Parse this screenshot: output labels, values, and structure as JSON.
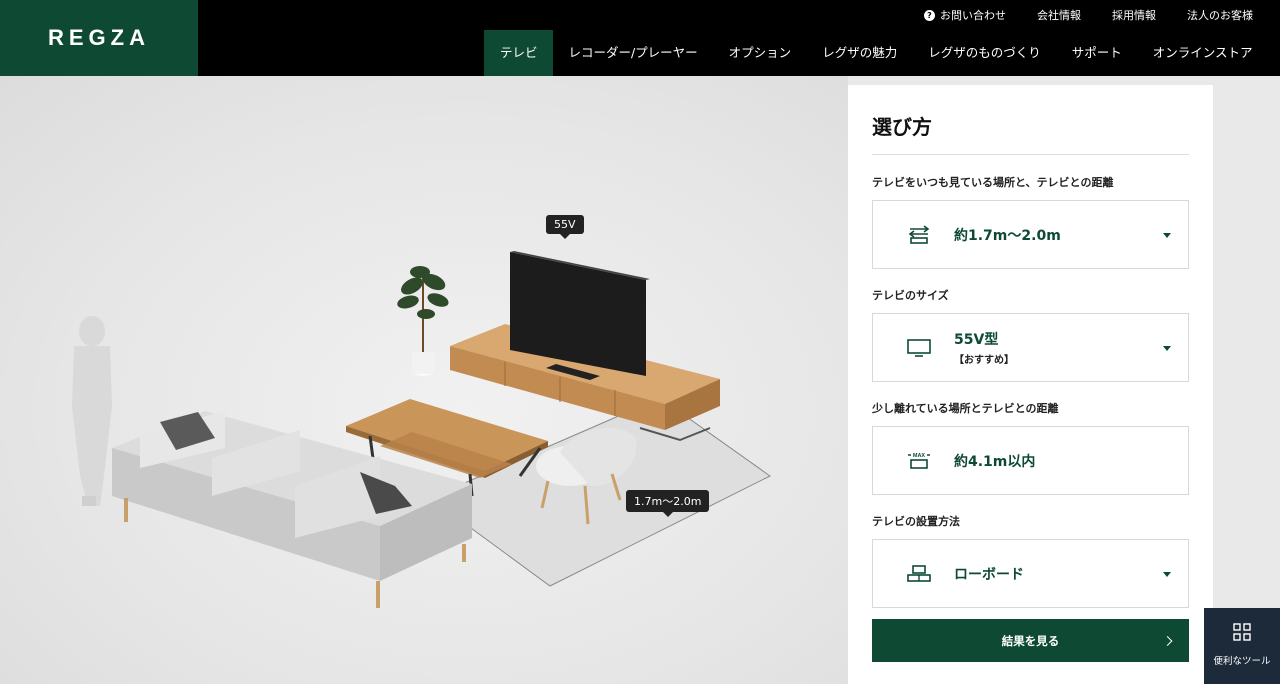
{
  "header": {
    "logo": "REGZA",
    "util_links": [
      "お問い合わせ",
      "会社情報",
      "採用情報",
      "法人のお客様"
    ],
    "nav": [
      "テレビ",
      "レコーダー/プレーヤー",
      "オプション",
      "レグザの魅力",
      "レグザのものづくり",
      "サポート",
      "オンラインストア"
    ],
    "nav_active": "テレビ"
  },
  "scene": {
    "tv_size_tag": "55V",
    "distance_tag": "1.7m〜2.0m"
  },
  "panel": {
    "title": "選び方",
    "fields": [
      {
        "label": "テレビをいつも見ている場所と、テレビとの距離",
        "value": "約1.7m〜2.0m",
        "sub": "",
        "icon": "distance-arrows-icon",
        "has_dropdown": true
      },
      {
        "label": "テレビのサイズ",
        "value": "55V型",
        "sub": "【おすすめ】",
        "icon": "tv-monitor-icon",
        "has_dropdown": true
      },
      {
        "label": "少し離れている場所とテレビとの距離",
        "value": "約4.1m以内",
        "sub": "",
        "icon": "max-distance-icon",
        "has_dropdown": false
      },
      {
        "label": "テレビの設置方法",
        "value": "ローボード",
        "sub": "",
        "icon": "lowboard-icon",
        "has_dropdown": true
      }
    ],
    "result_button": "結果を見る"
  },
  "tools": {
    "label": "便利なツール"
  },
  "colors": {
    "brand_green": "#0e4a33",
    "header_black": "#000000",
    "tool_navy": "#1d2a3a"
  }
}
